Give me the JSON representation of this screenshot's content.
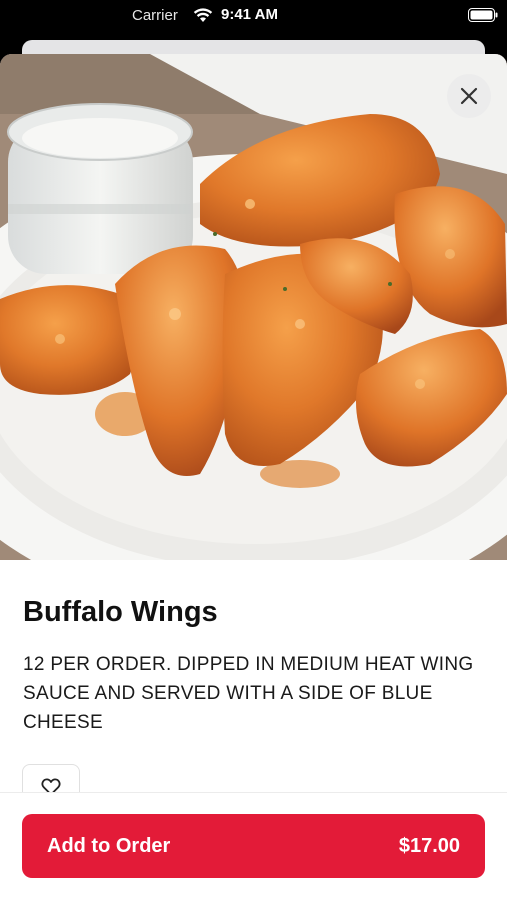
{
  "status_bar": {
    "carrier": "Carrier",
    "time": "9:41 AM"
  },
  "item": {
    "name": "Buffalo Wings",
    "description": "12 PER ORDER.  DIPPED IN MEDIUM HEAT WING SAUCE AND SERVED WITH A SIDE OF BLUE CHEESE",
    "image_alt": "Plate of buffalo wings with a jar of blue cheese dip"
  },
  "actions": {
    "add_label": "Add to Order",
    "price": "$17.00"
  },
  "icons": {
    "close": "close-icon",
    "favorite": "heart-outline-icon",
    "wifi": "wifi-icon",
    "battery": "battery-icon"
  },
  "colors": {
    "accent": "#e31b38",
    "text": "#111111"
  }
}
